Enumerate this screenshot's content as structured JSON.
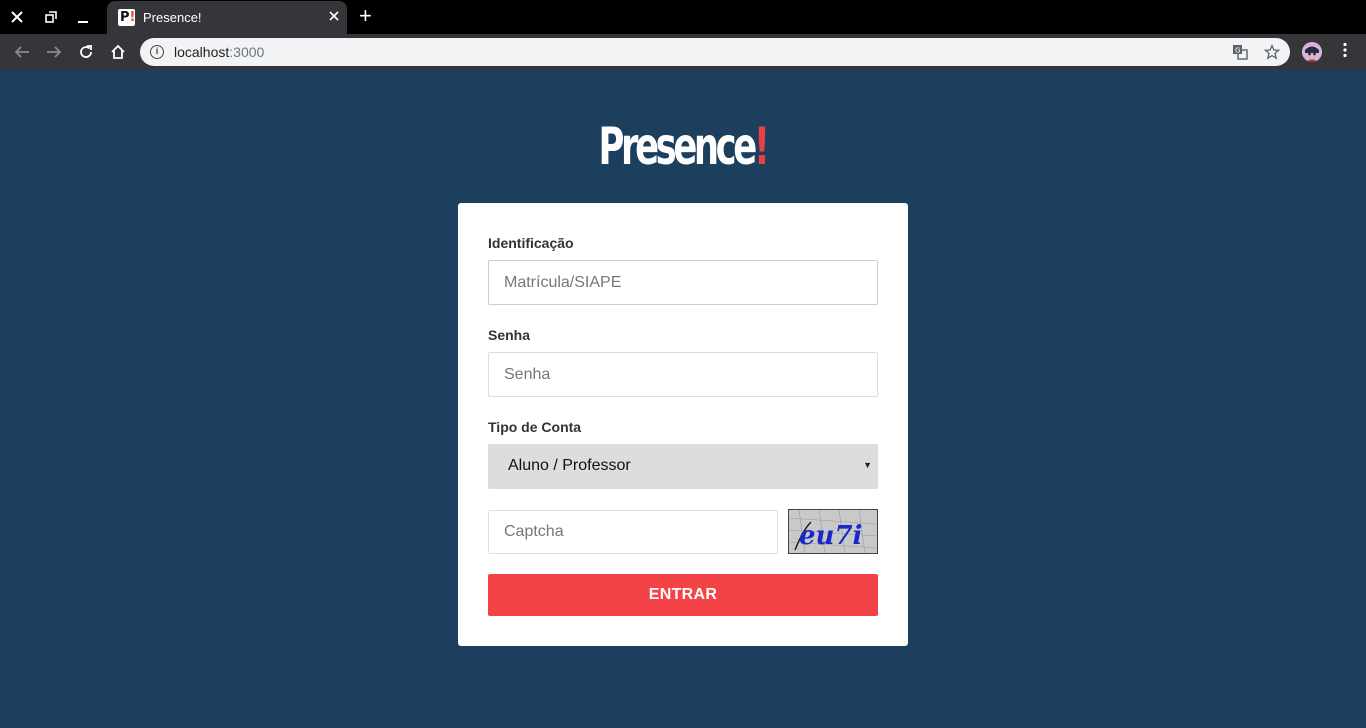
{
  "browser": {
    "tab_title": "Presence!",
    "favicon_text": "P",
    "favicon_bang": "!",
    "url_host": "localhost",
    "url_port": ":3000",
    "new_tab_label": "+"
  },
  "logo": {
    "text": "Presence",
    "bang": "!"
  },
  "form": {
    "identification_label": "Identificação",
    "identification_placeholder": "Matrícula/SIAPE",
    "password_label": "Senha",
    "password_placeholder": "Senha",
    "account_type_label": "Tipo de Conta",
    "account_type_selected": "Aluno / Professor",
    "captcha_placeholder": "Captcha",
    "captcha_image_text": "eu7i",
    "submit_label": "ENTRAR"
  },
  "colors": {
    "page_background": "#1d3f5e",
    "accent": "#f44346",
    "select_background": "#dddddd"
  },
  "icons": {
    "window_close": "close-icon",
    "window_restore": "restore-icon",
    "window_minimize": "minimize-icon",
    "back": "arrow-left-icon",
    "forward": "arrow-right-icon",
    "reload": "reload-icon",
    "home": "home-icon",
    "site_info": "info-icon",
    "translate": "translate-icon",
    "bookmark": "star-icon",
    "menu": "more-vertical-icon"
  }
}
